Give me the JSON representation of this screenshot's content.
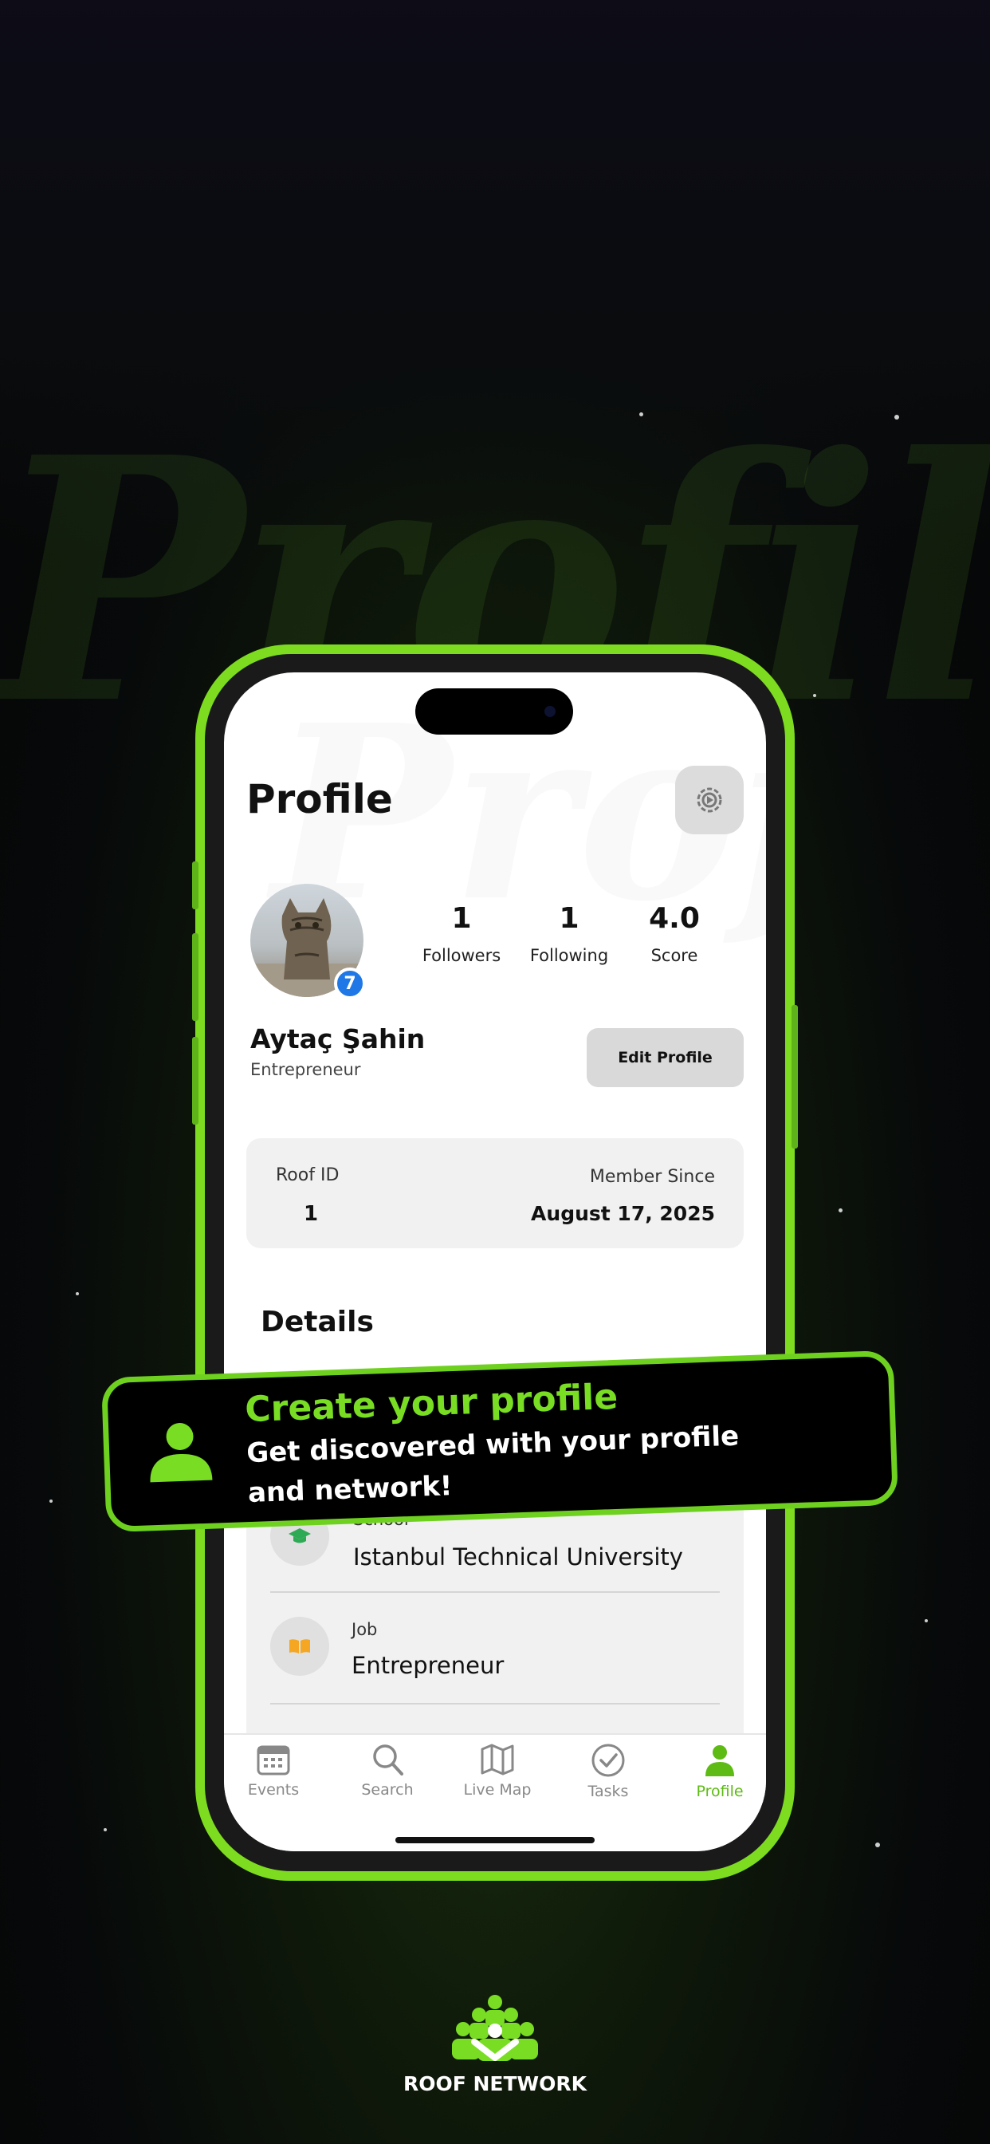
{
  "background": {
    "watermark_text": "Profile"
  },
  "colors": {
    "accent": "#6fd11f",
    "badge": "#1f78e6",
    "text_dark": "#111111"
  },
  "screen": {
    "title": "Profile",
    "settings_icon": "gear-icon",
    "profile": {
      "level_badge": "7",
      "name": "Aytaç Şahin",
      "role": "Entrepreneur",
      "edit_label": "Edit Profile"
    },
    "stats": [
      {
        "value": "1",
        "label": "Followers"
      },
      {
        "value": "1",
        "label": "Following"
      },
      {
        "value": "4.0",
        "label": "Score"
      }
    ],
    "id_card": {
      "roof_id_label": "Roof ID",
      "roof_id_value": "1",
      "member_since_label": "Member Since",
      "member_since_value": "August 17, 2025"
    },
    "details": {
      "heading": "Details",
      "rows": [
        {
          "label": "School",
          "value": "Istanbul Technical University",
          "icon": "graduation-cap-icon"
        },
        {
          "label": "Job",
          "value": "Entrepreneur",
          "icon": "book-icon"
        }
      ]
    },
    "tabs": [
      {
        "label": "Events",
        "icon": "calendar-icon"
      },
      {
        "label": "Search",
        "icon": "search-icon"
      },
      {
        "label": "Live Map",
        "icon": "map-icon"
      },
      {
        "label": "Tasks",
        "icon": "check-circle-icon"
      },
      {
        "label": "Profile",
        "icon": "person-icon",
        "active": true
      }
    ]
  },
  "banner": {
    "title": "Create your profile",
    "subtitle_line1": "Get discovered with your profile",
    "subtitle_line2": "and network!"
  },
  "brand": {
    "name": "ROOF NETWORK"
  }
}
